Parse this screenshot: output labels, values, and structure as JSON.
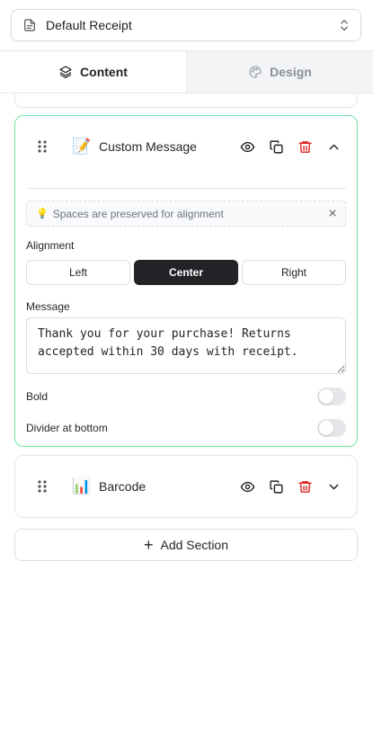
{
  "template_select": {
    "value": "Default Receipt",
    "doc_icon": "document-icon",
    "chevron_icon": "chevrons-up-down-icon"
  },
  "tabs": [
    {
      "label": "Content",
      "icon": "layers-icon",
      "active": true
    },
    {
      "label": "Design",
      "icon": "palette-icon",
      "active": false
    }
  ],
  "sections": {
    "custom_message": {
      "title": "Custom Message",
      "emoji": "📝",
      "hint": "Spaces are preserved for alignment",
      "hint_emoji": "💡",
      "alignment_label": "Alignment",
      "alignment_options": [
        "Left",
        "Center",
        "Right"
      ],
      "alignment_selected": "Center",
      "message_label": "Message",
      "message_value": "Thank you for your purchase! Returns accepted within 30 days with receipt.",
      "bold_label": "Bold",
      "bold_on": false,
      "divider_label": "Divider at bottom",
      "divider_on": false,
      "expanded": true
    },
    "barcode": {
      "title": "Barcode",
      "emoji": "📊",
      "expanded": false
    }
  },
  "add_section_label": "Add Section",
  "colors": {
    "accent_border": "#6ee7a6",
    "delete_red": "#dc2626",
    "selected_dark": "#222326"
  }
}
